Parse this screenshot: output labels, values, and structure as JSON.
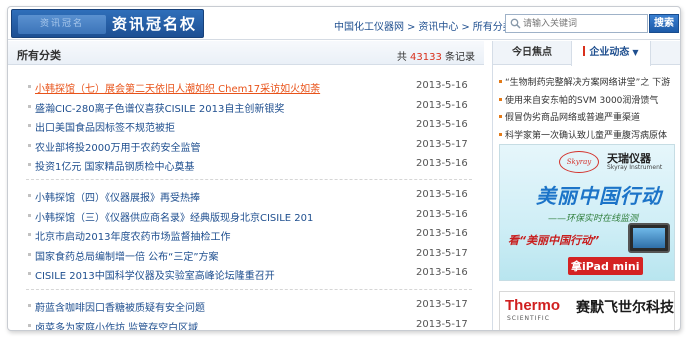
{
  "logo": {
    "emblem_text": "资讯冠名",
    "title": "资讯冠名权"
  },
  "breadcrumb": [
    "中国化工仪器网",
    "资讯中心",
    "所有分类"
  ],
  "breadcrumb_sep": ">",
  "search": {
    "placeholder": "请输入关键词",
    "button_label": "搜索"
  },
  "section": {
    "title": "所有分类",
    "total_prefix": "共",
    "total_count": "43133",
    "total_suffix": "条记录"
  },
  "news_groups": [
    [
      {
        "title": "小韩探馆（七）展会第二天依旧人潮如织 Chem17采访如火如荼",
        "date": "2013-5-16",
        "highlighted": true
      },
      {
        "title": "盛瀚CIC-280离子色谱仪喜获CISILE 2013自主创新银奖",
        "date": "2013-5-16"
      },
      {
        "title": "出口美国食品因标签不规范被拒",
        "date": "2013-5-16"
      },
      {
        "title": "农业部将投2000万用于农药安全监管",
        "date": "2013-5-17"
      },
      {
        "title": "投资1亿元 国家精品钢质检中心奠基",
        "date": "2013-5-16"
      }
    ],
    [
      {
        "title": "小韩探馆（四）《仪器展报》再受热捧",
        "date": "2013-5-16"
      },
      {
        "title": "小韩探馆（三）《仪器供应商名录》经典版现身北京CISILE 201",
        "date": "2013-5-16"
      },
      {
        "title": "北京市启动2013年度农药市场监督抽检工作",
        "date": "2013-5-16"
      },
      {
        "title": "国家食药总局编制增一倍 公布“三定”方案",
        "date": "2013-5-17"
      },
      {
        "title": "CISILE 2013中国科学仪器及实验室高峰论坛隆重召开",
        "date": "2013-5-16"
      }
    ],
    [
      {
        "title": "蔚蓝含咖啡因口香糖被质疑有安全问题",
        "date": "2013-5-17"
      },
      {
        "title": "卤菜多为家庭小作坊 监管存空白区域",
        "date": "2013-5-17"
      }
    ]
  ],
  "side_tabs": {
    "tab1": "今日焦点",
    "tab2": "企业动态"
  },
  "side_items": [
    "“生物制药完整解决方案网络讲堂”之 下游",
    "使用来自安东帕的SVM 3000润滑馈气",
    "假冒伪劣商品网络或普遍严重渠道",
    "科学家第一次确认致儿童严重腹泻病原体"
  ],
  "ad1": {
    "brand_logo": "Skyray",
    "brand_zh": "天瑞仪器",
    "brand_en": "Skyray Instrument",
    "slogan": "美丽中国行动",
    "sub": "——环保实时在线监测",
    "see": "看“美丽中国行动”",
    "take": "拿iPad mini"
  },
  "ad2": {
    "brand": "Thermo",
    "scientific": "SCIENTIFIC",
    "cn": "赛默飞世尔科技"
  },
  "colors": {
    "link": "#1f4f8f",
    "highlight": "#e8531a",
    "accent_red": "#d9301c",
    "header_blue": "#1d4f93"
  }
}
